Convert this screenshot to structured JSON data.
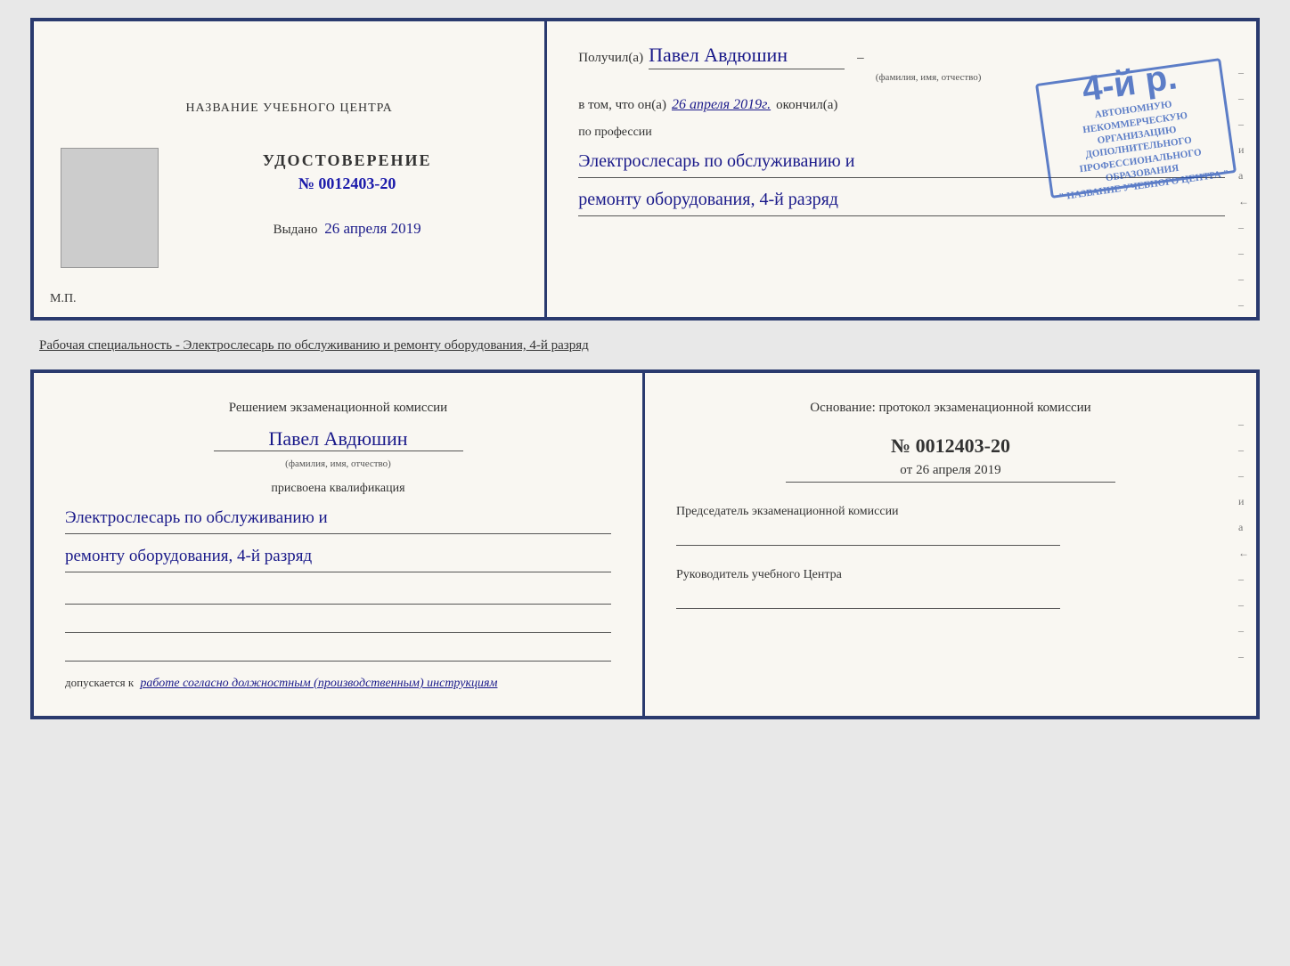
{
  "top_cert": {
    "left": {
      "school_name": "НАЗВАНИЕ УЧЕБНОГО ЦЕНТРА",
      "cert_title": "УДОСТОВЕРЕНИЕ",
      "cert_number": "№ 0012403-20",
      "issued_label": "Выдано",
      "issued_date": "26 апреля 2019",
      "mp_label": "М.П."
    },
    "right": {
      "recipient_prefix": "Получил(а)",
      "recipient_name": "Павел Авдюшин",
      "recipient_subtitle": "(фамилия, имя, отчество)",
      "in_that_prefix": "в том, что он(а)",
      "in_that_date": "26 апреля 2019г.",
      "in_that_finished": "окончил(а)",
      "stamp_big": "4-й р.",
      "stamp_line1": "АВТОНОМНУЮ НЕКОММЕРЧЕСКУЮ ОРГАНИЗАЦИЮ",
      "stamp_line2": "ДОПОЛНИТЕЛЬНОГО ПРОФЕССИОНАЛЬНОГО ОБРАЗОВАНИЯ",
      "stamp_line3": "\" НАЗВАНИЕ УЧЕБНОГО ЦЕНТРА \"",
      "profession_prefix": "по профессии",
      "profession_line1": "Электрослесарь по обслуживанию и",
      "profession_line2": "ремонту оборудования, 4-й разряд"
    }
  },
  "middle_text": "Рабочая специальность - Электрослесарь по обслуживанию и ремонту оборудования, 4-й разряд",
  "bottom_cert": {
    "left": {
      "title": "Решением экзаменационной комиссии",
      "name": "Павел Авдюшин",
      "name_subtitle": "(фамилия, имя, отчество)",
      "assigned_label": "присвоена квалификация",
      "profession_line1": "Электрослесарь по обслуживанию и",
      "profession_line2": "ремонту оборудования, 4-й разряд",
      "allowed_label": "допускается к",
      "allowed_text": "работе согласно должностным (производственным) инструкциям"
    },
    "right": {
      "basis_prefix": "Основание: протокол экзаменационной комиссии",
      "basis_number": "№ 0012403-20",
      "basis_date_prefix": "от",
      "basis_date": "26 апреля 2019",
      "chairman_label": "Председатель экзаменационной комиссии",
      "director_label": "Руководитель учебного Центра"
    }
  },
  "side_marks": {
    "mark1": "–",
    "mark2": "–",
    "mark3": "–",
    "mark4": "и",
    "mark5": "а",
    "mark6": "←",
    "mark7": "–",
    "mark8": "–",
    "mark9": "–",
    "mark10": "–"
  }
}
